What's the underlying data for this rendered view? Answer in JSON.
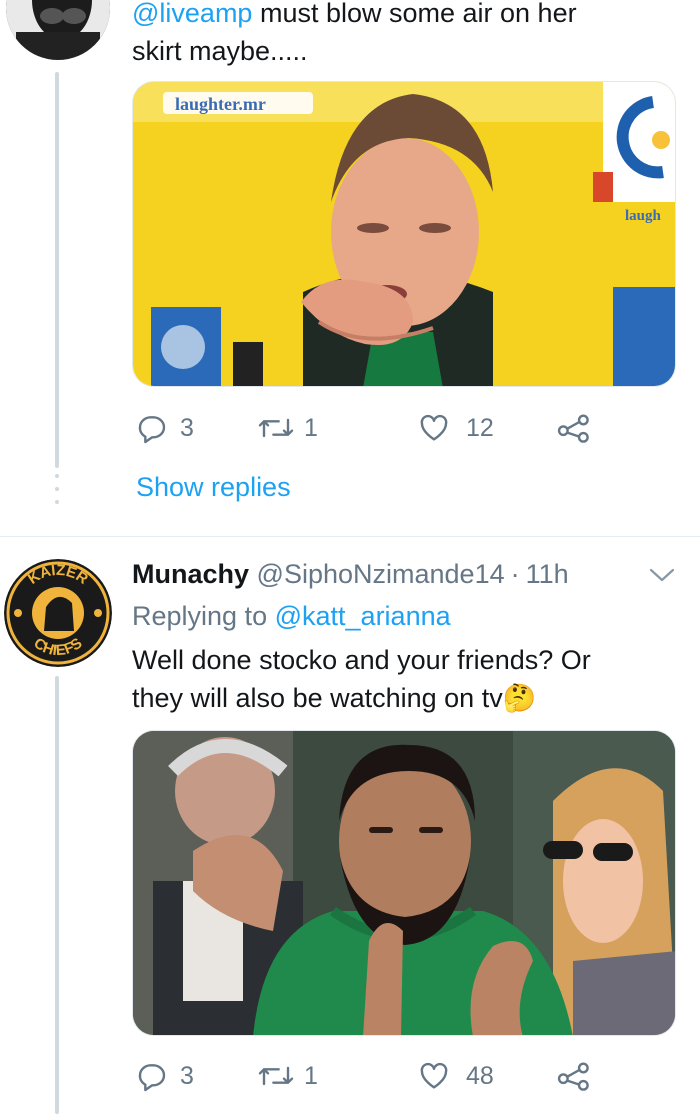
{
  "tweet1": {
    "text_mention": "@liveamp",
    "text_rest_line1": " must blow some air on her",
    "text_line2": "skirt maybe.....",
    "media": {
      "watermark": "laughter.mr",
      "watermark_right": "laugh"
    },
    "actions": {
      "reply_count": "3",
      "retweet_count": "1",
      "like_count": "12"
    },
    "show_replies": "Show replies"
  },
  "tweet2": {
    "author_name": "Munachy",
    "author_handle": "@SiphoNzimande14",
    "separator": "·",
    "time": "11h",
    "replying_to_label": "Replying to",
    "replying_to_handle": "@katt_arianna",
    "text_line1": "Well done stocko and your friends? Or",
    "text_line2": "they will also be watching on tv",
    "emoji": "🤔",
    "avatar_text_top": "KAIZER",
    "avatar_text_bottom": "CHIEFS",
    "actions": {
      "reply_count": "3",
      "retweet_count": "1",
      "like_count": "48"
    }
  },
  "colors": {
    "accent": "#1da1f2",
    "muted": "#657786",
    "thread_line": "#cfd9de"
  },
  "icons": [
    "reply-icon",
    "retweet-icon",
    "like-icon",
    "share-icon",
    "chevron-down-icon"
  ]
}
